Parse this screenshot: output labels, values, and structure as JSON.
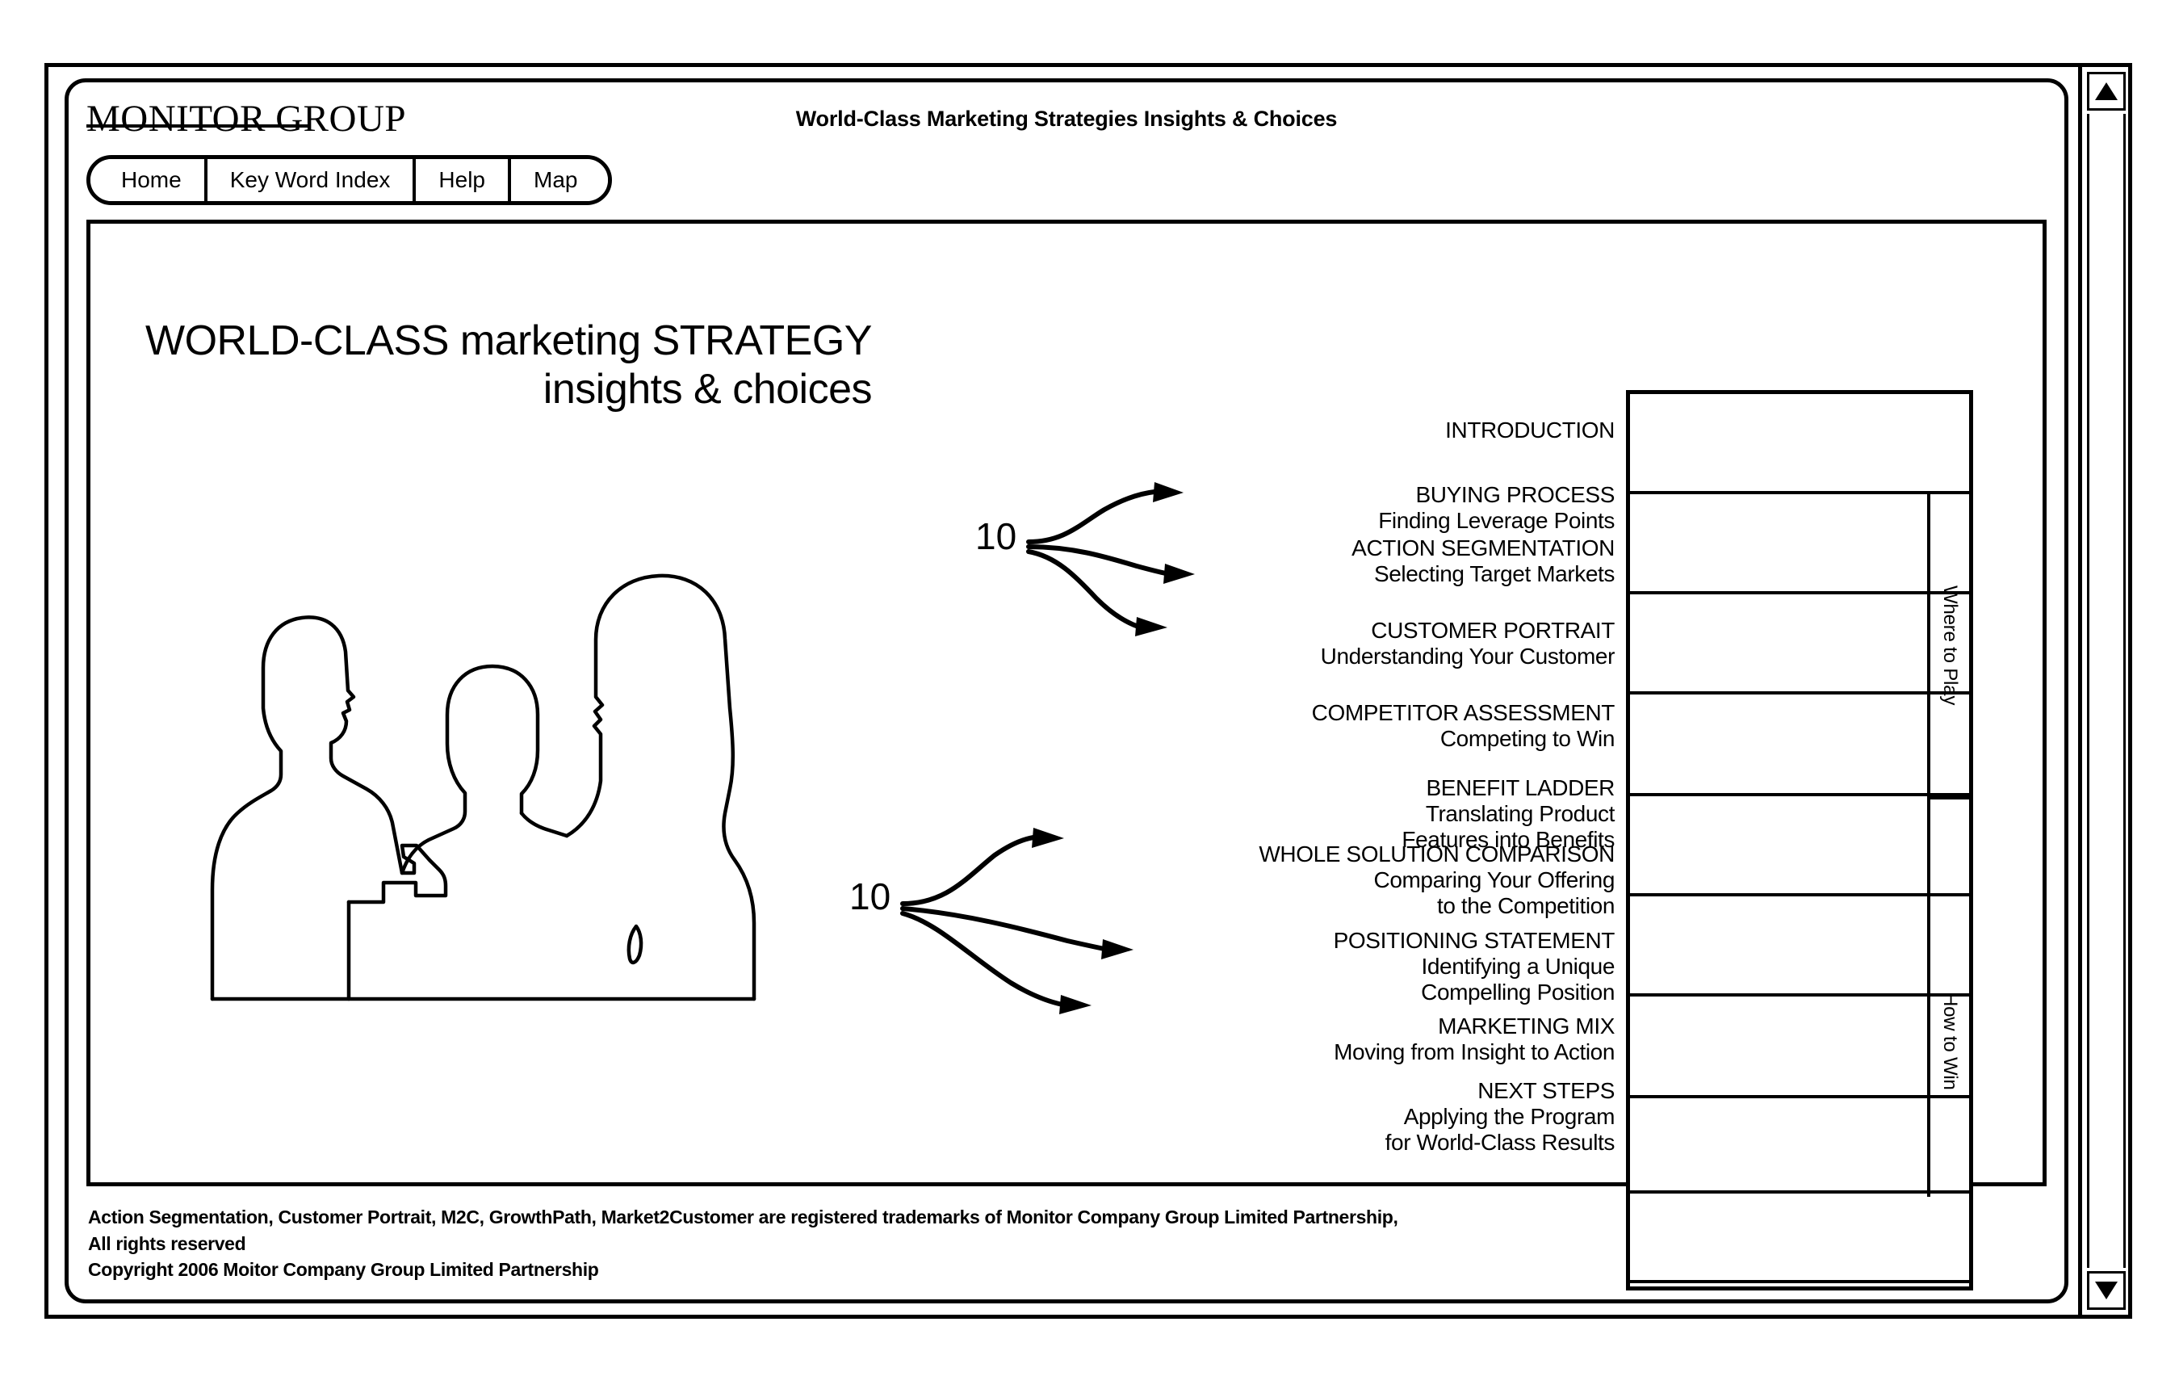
{
  "window": {
    "scrollbar": {
      "up_icon": "triangle-up-icon",
      "down_icon": "triangle-down-icon"
    }
  },
  "header": {
    "brand": "MONITOR GROUP",
    "title": "World-Class Marketing Strategies Insights & Choices"
  },
  "nav": {
    "items": [
      {
        "label": "Home"
      },
      {
        "label": "Key Word Index"
      },
      {
        "label": "Help"
      },
      {
        "label": "Map"
      }
    ]
  },
  "hero": {
    "line1": "WORLD-CLASS marketing STRATEGY",
    "line2": "insights & choices",
    "illustration_name": "three-people-silhouette-illustration"
  },
  "modules": [
    {
      "title": "INTRODUCTION",
      "subtitle": ""
    },
    {
      "title": "BUYING PROCESS",
      "subtitle": "Finding Leverage Points"
    },
    {
      "title": "ACTION SEGMENTATION",
      "subtitle": "Selecting Target Markets"
    },
    {
      "title": "CUSTOMER PORTRAIT",
      "subtitle": "Understanding Your Customer"
    },
    {
      "title": "COMPETITOR ASSESSMENT",
      "subtitle": "Competing to Win"
    },
    {
      "title": "BENEFIT LADDER",
      "subtitle": "Translating Product\nFeatures into Benefits"
    },
    {
      "title": "WHOLE SOLUTION COMPARISON",
      "subtitle": "Comparing Your Offering\nto the Competition"
    },
    {
      "title": "POSITIONING STATEMENT",
      "subtitle": "Identifying a Unique\nCompelling Position"
    },
    {
      "title": "MARKETING MIX",
      "subtitle": "Moving from Insight to Action"
    },
    {
      "title": "NEXT STEPS",
      "subtitle": "Applying the Program\nfor World-Class Results"
    }
  ],
  "phases": [
    {
      "label": "Where to Play"
    },
    {
      "label": "How to Win"
    }
  ],
  "clusters": [
    {
      "number": "10",
      "targets": [
        "BUYING PROCESS",
        "ACTION SEGMENTATION",
        "CUSTOMER PORTRAIT"
      ]
    },
    {
      "number": "10",
      "targets": [
        "WHOLE SOLUTION COMPARISON",
        "POSITIONING STATEMENT",
        "MARKETING MIX"
      ]
    }
  ],
  "footer": {
    "line1": "Action Segmentation, Customer Portrait, M2C, GrowthPath, Market2Customer are registered trademarks of Monitor Company Group Limited Partnership,",
    "line2": "All rights reserved",
    "line3": "Copyright 2006 Moitor Company Group Limited Partnership"
  }
}
